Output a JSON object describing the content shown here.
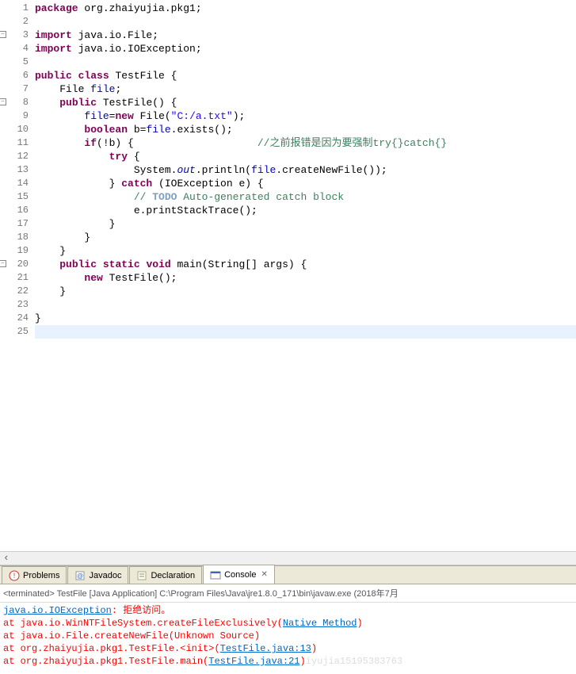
{
  "code": {
    "lines": [
      {
        "n": 1,
        "fold": "",
        "tokens": [
          {
            "t": "package",
            "c": "kw"
          },
          {
            "t": " org.zhaiyujia.pkg1;",
            "c": ""
          }
        ]
      },
      {
        "n": 2,
        "fold": "",
        "tokens": []
      },
      {
        "n": 3,
        "fold": "⊖",
        "tokens": [
          {
            "t": "import",
            "c": "kw"
          },
          {
            "t": " java.io.File;",
            "c": ""
          }
        ]
      },
      {
        "n": 4,
        "fold": "",
        "tokens": [
          {
            "t": "import",
            "c": "kw"
          },
          {
            "t": " java.io.IOException;",
            "c": ""
          }
        ]
      },
      {
        "n": 5,
        "fold": "",
        "tokens": []
      },
      {
        "n": 6,
        "fold": "",
        "tokens": [
          {
            "t": "public",
            "c": "kw"
          },
          {
            "t": " ",
            "c": ""
          },
          {
            "t": "class",
            "c": "kw"
          },
          {
            "t": " TestFile {",
            "c": ""
          }
        ]
      },
      {
        "n": 7,
        "fold": "",
        "tokens": [
          {
            "t": "    File ",
            "c": ""
          },
          {
            "t": "file",
            "c": "field"
          },
          {
            "t": ";",
            "c": ""
          }
        ]
      },
      {
        "n": 8,
        "fold": "⊖",
        "tokens": [
          {
            "t": "    ",
            "c": ""
          },
          {
            "t": "public",
            "c": "kw"
          },
          {
            "t": " TestFile() {",
            "c": ""
          }
        ]
      },
      {
        "n": 9,
        "fold": "",
        "tokens": [
          {
            "t": "        ",
            "c": ""
          },
          {
            "t": "file",
            "c": "field"
          },
          {
            "t": "=",
            "c": ""
          },
          {
            "t": "new",
            "c": "kw"
          },
          {
            "t": " File(",
            "c": ""
          },
          {
            "t": "\"C:/a.txt\"",
            "c": "str"
          },
          {
            "t": ");",
            "c": ""
          }
        ]
      },
      {
        "n": 10,
        "fold": "",
        "tokens": [
          {
            "t": "        ",
            "c": ""
          },
          {
            "t": "boolean",
            "c": "kw"
          },
          {
            "t": " b=",
            "c": ""
          },
          {
            "t": "file",
            "c": "field"
          },
          {
            "t": ".exists();",
            "c": ""
          }
        ]
      },
      {
        "n": 11,
        "fold": "",
        "tokens": [
          {
            "t": "        ",
            "c": ""
          },
          {
            "t": "if",
            "c": "kw"
          },
          {
            "t": "(!b) {                    ",
            "c": ""
          },
          {
            "t": "//之前报错是因为要强制try{}catch{}",
            "c": "com"
          }
        ]
      },
      {
        "n": 12,
        "fold": "",
        "tokens": [
          {
            "t": "            ",
            "c": ""
          },
          {
            "t": "try",
            "c": "kw"
          },
          {
            "t": " {",
            "c": ""
          }
        ]
      },
      {
        "n": 13,
        "fold": "",
        "tokens": [
          {
            "t": "                System.",
            "c": ""
          },
          {
            "t": "out",
            "c": "static-field"
          },
          {
            "t": ".println(",
            "c": ""
          },
          {
            "t": "file",
            "c": "field"
          },
          {
            "t": ".createNewFile());",
            "c": ""
          }
        ]
      },
      {
        "n": 14,
        "fold": "",
        "tokens": [
          {
            "t": "            } ",
            "c": ""
          },
          {
            "t": "catch",
            "c": "kw"
          },
          {
            "t": " (IOException e) {",
            "c": ""
          }
        ]
      },
      {
        "n": 15,
        "fold": "",
        "tokens": [
          {
            "t": "                ",
            "c": ""
          },
          {
            "t": "// ",
            "c": "com"
          },
          {
            "t": "TODO",
            "c": "todo"
          },
          {
            "t": " Auto-generated catch block",
            "c": "com"
          }
        ]
      },
      {
        "n": 16,
        "fold": "",
        "tokens": [
          {
            "t": "                e.printStackTrace();",
            "c": ""
          }
        ]
      },
      {
        "n": 17,
        "fold": "",
        "tokens": [
          {
            "t": "            }",
            "c": ""
          }
        ]
      },
      {
        "n": 18,
        "fold": "",
        "tokens": [
          {
            "t": "        }",
            "c": ""
          }
        ]
      },
      {
        "n": 19,
        "fold": "",
        "tokens": [
          {
            "t": "    }",
            "c": ""
          }
        ]
      },
      {
        "n": 20,
        "fold": "⊖",
        "tokens": [
          {
            "t": "    ",
            "c": ""
          },
          {
            "t": "public",
            "c": "kw"
          },
          {
            "t": " ",
            "c": ""
          },
          {
            "t": "static",
            "c": "kw"
          },
          {
            "t": " ",
            "c": ""
          },
          {
            "t": "void",
            "c": "kw"
          },
          {
            "t": " main(String[] args) {",
            "c": ""
          }
        ]
      },
      {
        "n": 21,
        "fold": "",
        "tokens": [
          {
            "t": "        ",
            "c": ""
          },
          {
            "t": "new",
            "c": "kw"
          },
          {
            "t": " TestFile();",
            "c": ""
          }
        ]
      },
      {
        "n": 22,
        "fold": "",
        "tokens": [
          {
            "t": "    }",
            "c": ""
          }
        ]
      },
      {
        "n": 23,
        "fold": "",
        "tokens": []
      },
      {
        "n": 24,
        "fold": "",
        "tokens": [
          {
            "t": "}",
            "c": ""
          }
        ]
      },
      {
        "n": 25,
        "fold": "",
        "tokens": [],
        "hl": true
      }
    ]
  },
  "tabs": {
    "problems": "Problems",
    "javadoc": "Javadoc",
    "declaration": "Declaration",
    "console": "Console"
  },
  "terminated": "<terminated> TestFile [Java Application] C:\\Program Files\\Java\\jre1.8.0_171\\bin\\javaw.exe (2018年7月",
  "console_out": {
    "l1_link": "java.io.IOException",
    "l1_rest": ": 拒绝访问。",
    "l2_a": "        at java.io.WinNTFileSystem.createFileExclusively(",
    "l2_link": "Native Method",
    "l2_b": ")",
    "l3": "        at java.io.File.createNewFile(Unknown Source)",
    "l4_a": "        at org.zhaiyujia.pkg1.TestFile.<init>(",
    "l4_link": "TestFile.java:13",
    "l4_b": ")",
    "l5_a": "        at org.zhaiyujia.pkg1.TestFile.main(",
    "l5_link": "TestFile.java:21",
    "l5_b": ")",
    "watermark": "iyujia15195383763"
  }
}
